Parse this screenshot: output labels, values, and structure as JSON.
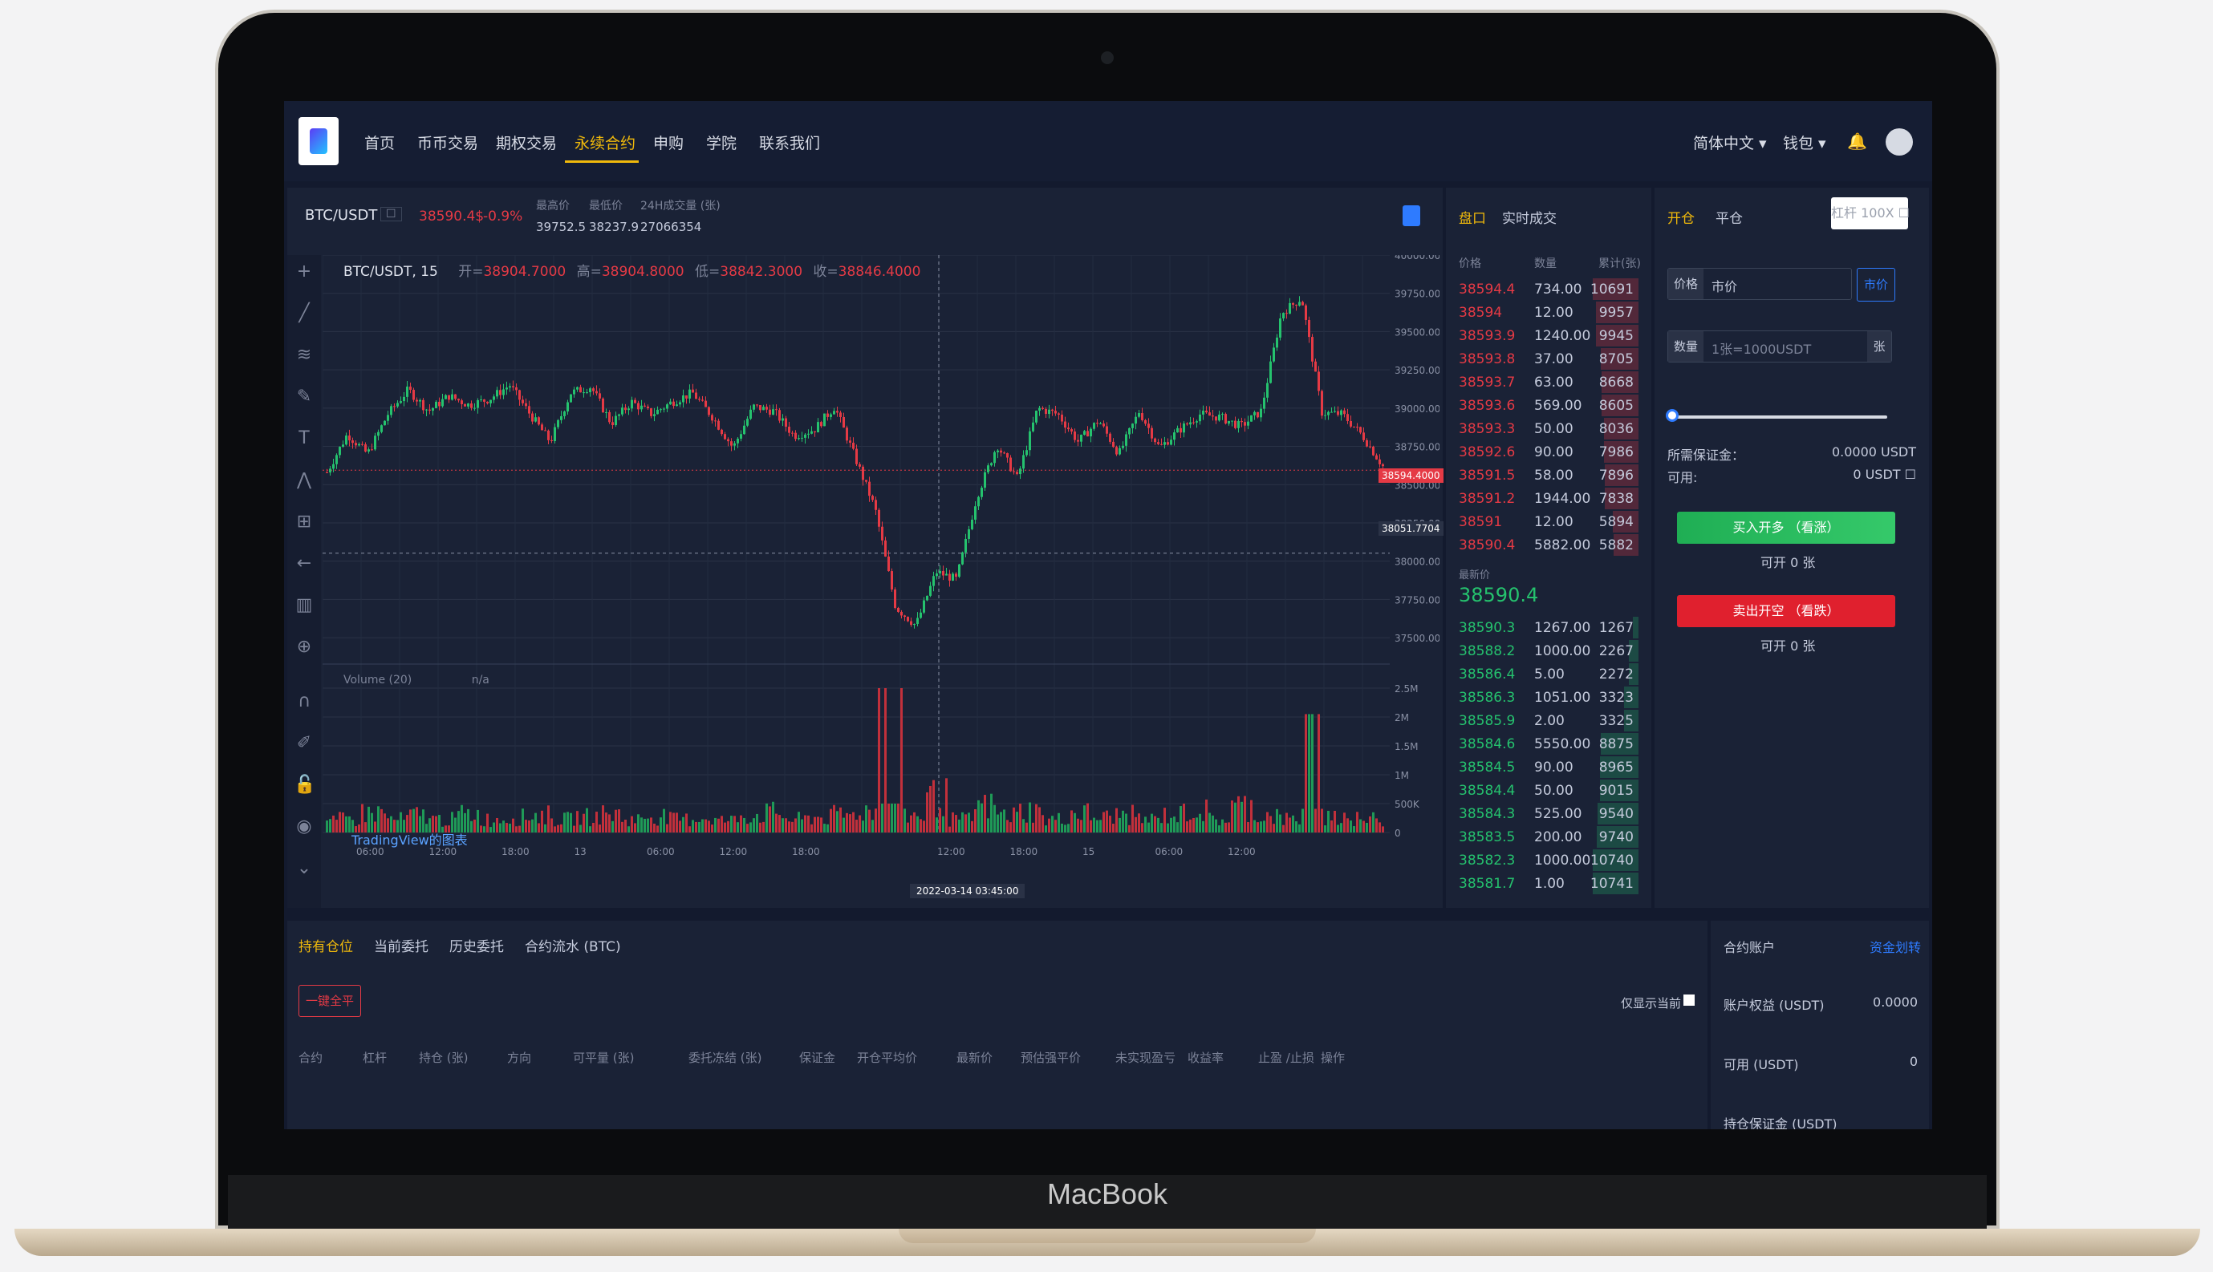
{
  "device_label": "MacBook",
  "nav": {
    "items": [
      "首页",
      "币币交易",
      "期权交易",
      "永续合约",
      "申购",
      "学院",
      "联系我们"
    ],
    "active_index": 3,
    "language": "简体中文",
    "wallet": "钱包"
  },
  "ticker": {
    "pair": "BTC/USDT",
    "pair_icon": "☐",
    "price": "38590.4$",
    "change": "-0.9%",
    "high_label": "最高价",
    "low_label": "最低价",
    "vol_label": "24H成交量 (张)",
    "high": "39752.5",
    "low": "38237.9",
    "volume": "27066354"
  },
  "chart": {
    "legend_title": "BTC/USDT, 15",
    "open_label": "开=",
    "open": "38904.7000",
    "high_label": "高=",
    "high": "38904.8000",
    "low_label": "低=",
    "low": "38842.3000",
    "close_label": "收=",
    "close": "38846.4000",
    "volume_label": "Volume (20)",
    "volume_value": "n/a",
    "watermark": "TradingView的图表",
    "price_tag": "38594.4000",
    "crosshair_tag": "38051.7704",
    "date_tag": "2022-03-14 03:45:00"
  },
  "chart_data": {
    "type": "candlestick",
    "title": "BTC/USDT, 15",
    "y_ticks": [
      "40000.0000",
      "39750.0000",
      "39500.0000",
      "39250.0000",
      "39000.0000",
      "38750.0000",
      "38500.0000",
      "38250.0000",
      "38000.0000",
      "37750.0000",
      "37500.0000"
    ],
    "y_range": [
      37380,
      40000
    ],
    "volume_ticks": [
      "2.5M",
      "2M",
      "1.5M",
      "1M",
      "500K",
      "0"
    ],
    "x_ticks": [
      "06:00",
      "12:00",
      "18:00",
      "13",
      "06:00",
      "12:00",
      "18:00",
      "",
      "12:00",
      "18:00",
      "15",
      "06:00",
      "12:00"
    ],
    "price_series": [
      38580,
      38830,
      38700,
      38960,
      39120,
      38980,
      39080,
      39020,
      39060,
      39150,
      38960,
      38780,
      39100,
      39140,
      38900,
      39040,
      38960,
      39040,
      39100,
      38940,
      38740,
      39010,
      38980,
      38820,
      38860,
      39010,
      38680,
      38340,
      37700,
      37580,
      37930,
      37880,
      38420,
      38760,
      38540,
      39000,
      38960,
      38780,
      38920,
      38700,
      38980,
      38740,
      38860,
      38960,
      38940,
      38880,
      38980,
      39620,
      39720,
      38970,
      38960,
      38820,
      38620
    ],
    "volume_series": [
      0.25,
      0.3,
      0.45,
      0.3,
      0.4,
      0.3,
      0.42,
      0.3,
      0.35,
      0.4,
      0.3,
      0.36,
      0.42,
      0.3,
      0.38,
      0.3,
      0.34,
      0.28,
      0.4,
      0.45,
      0.3,
      0.35,
      0.4,
      0.5,
      2.5,
      0.4,
      0.8,
      0.3,
      0.6,
      0.4,
      0.5,
      0.3,
      0.45,
      0.35,
      0.4,
      0.3,
      0.4,
      0.5,
      0.3,
      0.6,
      0.4,
      0.3,
      2.05,
      0.4,
      0.3,
      0.3
    ]
  },
  "orderbook": {
    "tabs": [
      "盘口",
      "实时成交"
    ],
    "headers": [
      "价格",
      "数量",
      "累计(张)"
    ],
    "asks": [
      [
        "38594.4",
        "734.00",
        "10691"
      ],
      [
        "38594",
        "12.00",
        "9957"
      ],
      [
        "38593.9",
        "1240.00",
        "9945"
      ],
      [
        "38593.8",
        "37.00",
        "8705"
      ],
      [
        "38593.7",
        "63.00",
        "8668"
      ],
      [
        "38593.6",
        "569.00",
        "8605"
      ],
      [
        "38593.3",
        "50.00",
        "8036"
      ],
      [
        "38592.6",
        "90.00",
        "7986"
      ],
      [
        "38591.5",
        "58.00",
        "7896"
      ],
      [
        "38591.2",
        "1944.00",
        "7838"
      ],
      [
        "38591",
        "12.00",
        "5894"
      ],
      [
        "38590.4",
        "5882.00",
        "5882"
      ]
    ],
    "last_label": "最新价",
    "last": "38590.4",
    "bids": [
      [
        "38590.3",
        "1267.00",
        "1267"
      ],
      [
        "38588.2",
        "1000.00",
        "2267"
      ],
      [
        "38586.4",
        "5.00",
        "2272"
      ],
      [
        "38586.3",
        "1051.00",
        "3323"
      ],
      [
        "38585.9",
        "2.00",
        "3325"
      ],
      [
        "38584.6",
        "5550.00",
        "8875"
      ],
      [
        "38584.5",
        "90.00",
        "8965"
      ],
      [
        "38584.4",
        "50.00",
        "9015"
      ],
      [
        "38584.3",
        "525.00",
        "9540"
      ],
      [
        "38583.5",
        "200.00",
        "9740"
      ],
      [
        "38582.3",
        "1000.00",
        "10740"
      ],
      [
        "38581.7",
        "1.00",
        "10741"
      ]
    ]
  },
  "order_form": {
    "tab_open": "开仓",
    "tab_close": "平仓",
    "leverage": "杠杆 100X",
    "price_label": "价格",
    "price_value": "市价",
    "market_btn": "市价",
    "qty_label": "数量",
    "qty_placeholder": "1张=1000USDT",
    "qty_unit": "张",
    "margin_label": "所需保证金：",
    "margin_value": "0.0000 USDT",
    "avail_label": "可用:",
    "avail_value": "0 USDT",
    "buy_btn": "买入开多 （看涨）",
    "buy_avail": "可开 0 张",
    "sell_btn": "卖出开空 （看跌）",
    "sell_avail": "可开 0 张",
    "slider_value": 0
  },
  "positions": {
    "tabs": [
      "持有仓位",
      "当前委托",
      "历史委托",
      "合约流水 (BTC)"
    ],
    "close_all": "一键全平",
    "only_current": "仅显示当前",
    "headers": [
      "合约",
      "杠杆",
      "持仓 (张)",
      "方向",
      "可平量 (张)",
      "委托冻结 (张)",
      "保证金",
      "开仓平均价",
      "最新价",
      "预估强平价",
      "未实现盈亏",
      "收益率",
      "止盈 /止损",
      "操作"
    ]
  },
  "account": {
    "title": "合约账户",
    "transfer": "资金划转",
    "rows": [
      [
        "账户权益 (USDT)",
        "0.0000"
      ],
      [
        "可用 (USDT)",
        "0"
      ],
      [
        "持仓保证金 (USDT)",
        ""
      ]
    ]
  }
}
